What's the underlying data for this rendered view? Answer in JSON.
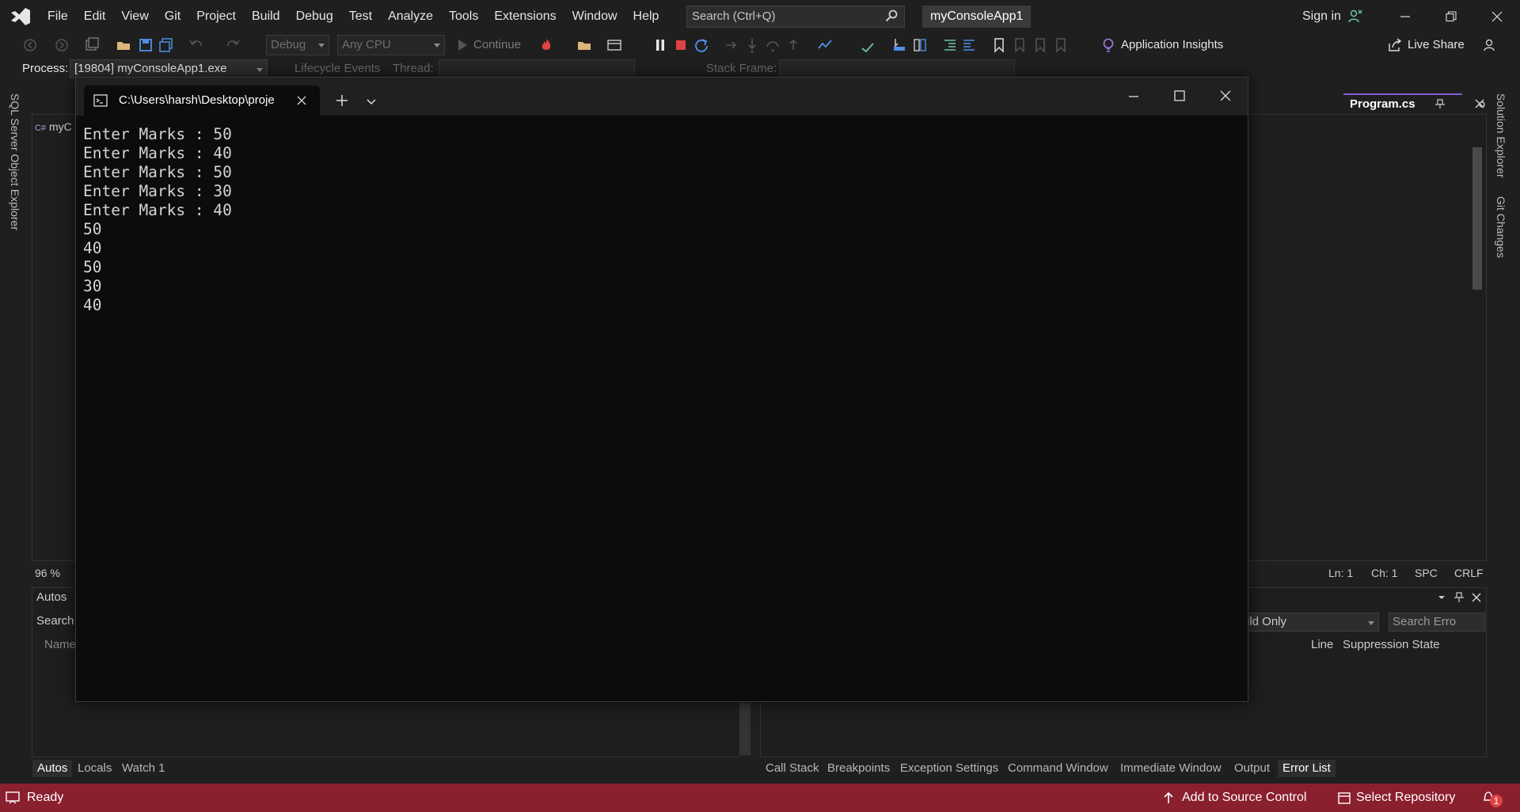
{
  "menu": [
    "File",
    "Edit",
    "View",
    "Git",
    "Project",
    "Build",
    "Debug",
    "Test",
    "Analyze",
    "Tools",
    "Extensions",
    "Window",
    "Help"
  ],
  "search": {
    "placeholder": "Search (Ctrl+Q)"
  },
  "solution_name": "myConsoleApp1",
  "account": {
    "signin_label": "Sign in"
  },
  "toolbar": {
    "config": "Debug",
    "platform": "Any CPU",
    "continue_label": "Continue",
    "app_insights": "Application Insights",
    "live_share": "Live Share"
  },
  "debug_location": {
    "process_label": "Process:",
    "process_value": "[19804] myConsoleApp1.exe",
    "lifecycle_label": "Lifecycle Events",
    "thread_label": "Thread:",
    "stack_frame_label": "Stack Frame:"
  },
  "left_tabs": [
    "SQL Server Object Explorer"
  ],
  "right_tabs": [
    "Solution Explorer",
    "Git Changes"
  ],
  "editor": {
    "tab_title": "Program.cs",
    "nav_project": "myC",
    "zoom": "96 %",
    "line": "Ln: 1",
    "char": "Ch: 1",
    "whitespace": "SPC",
    "line_ending": "CRLF"
  },
  "autos_pane": {
    "title": "Autos",
    "search_label": "Search",
    "name_header": "Name"
  },
  "error_pane": {
    "filter_value": "ild Only",
    "search_placeholder": "Search Erro",
    "line_header": "Line",
    "suppression_header": "Suppression State"
  },
  "bottom_tabs_left": [
    {
      "label": "Autos",
      "active": true
    },
    {
      "label": "Locals",
      "active": false
    },
    {
      "label": "Watch 1",
      "active": false
    }
  ],
  "bottom_tabs_right": [
    {
      "label": "Call Stack",
      "active": false
    },
    {
      "label": "Breakpoints",
      "active": false
    },
    {
      "label": "Exception Settings",
      "active": false
    },
    {
      "label": "Command Window",
      "active": false
    },
    {
      "label": "Immediate Window",
      "active": false
    },
    {
      "label": "Output",
      "active": false
    },
    {
      "label": "Error List",
      "active": true
    }
  ],
  "statusbar": {
    "ready": "Ready",
    "source_control": "Add to Source Control",
    "repository": "Select Repository",
    "notification_count": "1"
  },
  "terminal": {
    "tab_title": "C:\\Users\\harsh\\Desktop\\proje",
    "lines": [
      "Enter Marks : 50",
      "Enter Marks : 40",
      "Enter Marks : 50",
      "Enter Marks : 30",
      "Enter Marks : 40",
      "50",
      "40",
      "50",
      "30",
      "40"
    ]
  },
  "colors": {
    "statusbar_bg": "#8a1f2e",
    "accent_purple": "#8a5cd8",
    "stop_red": "#e04343"
  }
}
